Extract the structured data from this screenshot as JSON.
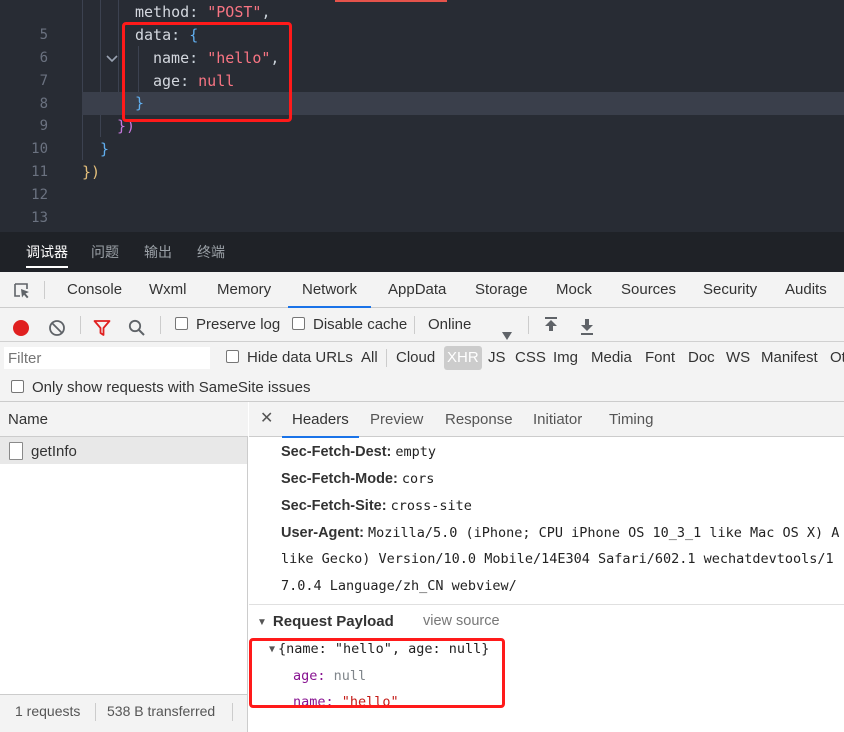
{
  "editor": {
    "lines": [
      {
        "num": "5",
        "tokens": [
          {
            "t": "method",
            "c": "k"
          },
          {
            "t": ": ",
            "c": "p"
          },
          {
            "t": "\"POST\"",
            "c": "s"
          },
          {
            "t": ",",
            "c": "p"
          }
        ]
      },
      {
        "num": "6",
        "tokens": [
          {
            "t": "data",
            "c": "k"
          },
          {
            "t": ": ",
            "c": "p"
          },
          {
            "t": "{",
            "c": "bb"
          }
        ]
      },
      {
        "num": "7",
        "tokens": [
          {
            "t": "name",
            "c": "k"
          },
          {
            "t": ": ",
            "c": "p"
          },
          {
            "t": "\"hello\"",
            "c": "s"
          },
          {
            "t": ",",
            "c": "p"
          }
        ]
      },
      {
        "num": "8",
        "tokens": [
          {
            "t": "age",
            "c": "k"
          },
          {
            "t": ": ",
            "c": "p"
          },
          {
            "t": "null",
            "c": "n"
          }
        ]
      },
      {
        "num": "9",
        "tokens": [
          {
            "t": "}",
            "c": "bb"
          }
        ]
      },
      {
        "num": "10",
        "tokens": [
          {
            "t": "})",
            "c": "bp"
          }
        ]
      },
      {
        "num": "11",
        "tokens": [
          {
            "t": "}",
            "c": "bb"
          }
        ]
      },
      {
        "num": "12",
        "tokens": [
          {
            "t": "})",
            "c": "by"
          }
        ]
      },
      {
        "num": "13",
        "tokens": []
      }
    ]
  },
  "panel_tabs": {
    "debugger": "调试器",
    "problems": "问题",
    "output": "输出",
    "terminal": "终端"
  },
  "devtools_tabs": {
    "console": "Console",
    "wxml": "Wxml",
    "memory": "Memory",
    "network": "Network",
    "appdata": "AppData",
    "storage": "Storage",
    "mock": "Mock",
    "sources": "Sources",
    "security": "Security",
    "audits": "Audits"
  },
  "toolbar": {
    "preserve_log": "Preserve log",
    "disable_cache": "Disable cache",
    "throttle": "Online"
  },
  "filter": {
    "placeholder": "Filter",
    "hide_data_urls": "Hide data URLs",
    "types": {
      "all": "All",
      "cloud": "Cloud",
      "xhr": "XHR",
      "js": "JS",
      "css": "CSS",
      "img": "Img",
      "media": "Media",
      "font": "Font",
      "doc": "Doc",
      "ws": "WS",
      "manifest": "Manifest",
      "other": "Ot"
    },
    "samesite": "Only show requests with SameSite issues"
  },
  "request_list": {
    "header": "Name",
    "items": [
      "getInfo"
    ]
  },
  "status": {
    "requests": "1 requests",
    "transferred": "538 B transferred"
  },
  "detail_tabs": {
    "headers": "Headers",
    "preview": "Preview",
    "response": "Response",
    "initiator": "Initiator",
    "timing": "Timing"
  },
  "headers": [
    {
      "name": "Sec-Fetch-Dest:",
      "value": "empty"
    },
    {
      "name": "Sec-Fetch-Mode:",
      "value": "cors"
    },
    {
      "name": "Sec-Fetch-Site:",
      "value": "cross-site"
    },
    {
      "name": "User-Agent:",
      "value": "Mozilla/5.0 (iPhone; CPU iPhone OS 10_3_1 like Mac OS X) A"
    }
  ],
  "user_agent_cont": [
    "like Gecko) Version/10.0 Mobile/14E304 Safari/602.1 wechatdevtools/1",
    "7.0.4 Language/zh_CN webview/"
  ],
  "payload": {
    "title": "Request Payload",
    "view_source": "view source",
    "summary": "{name: \"hello\", age: null}",
    "props": [
      {
        "key": "age",
        "value": "null"
      },
      {
        "key": "name",
        "value": "\"hello\""
      }
    ]
  },
  "colors": {
    "accent": "#1a73e8",
    "highlight": "#ff1a1a",
    "record": "#e02020"
  }
}
